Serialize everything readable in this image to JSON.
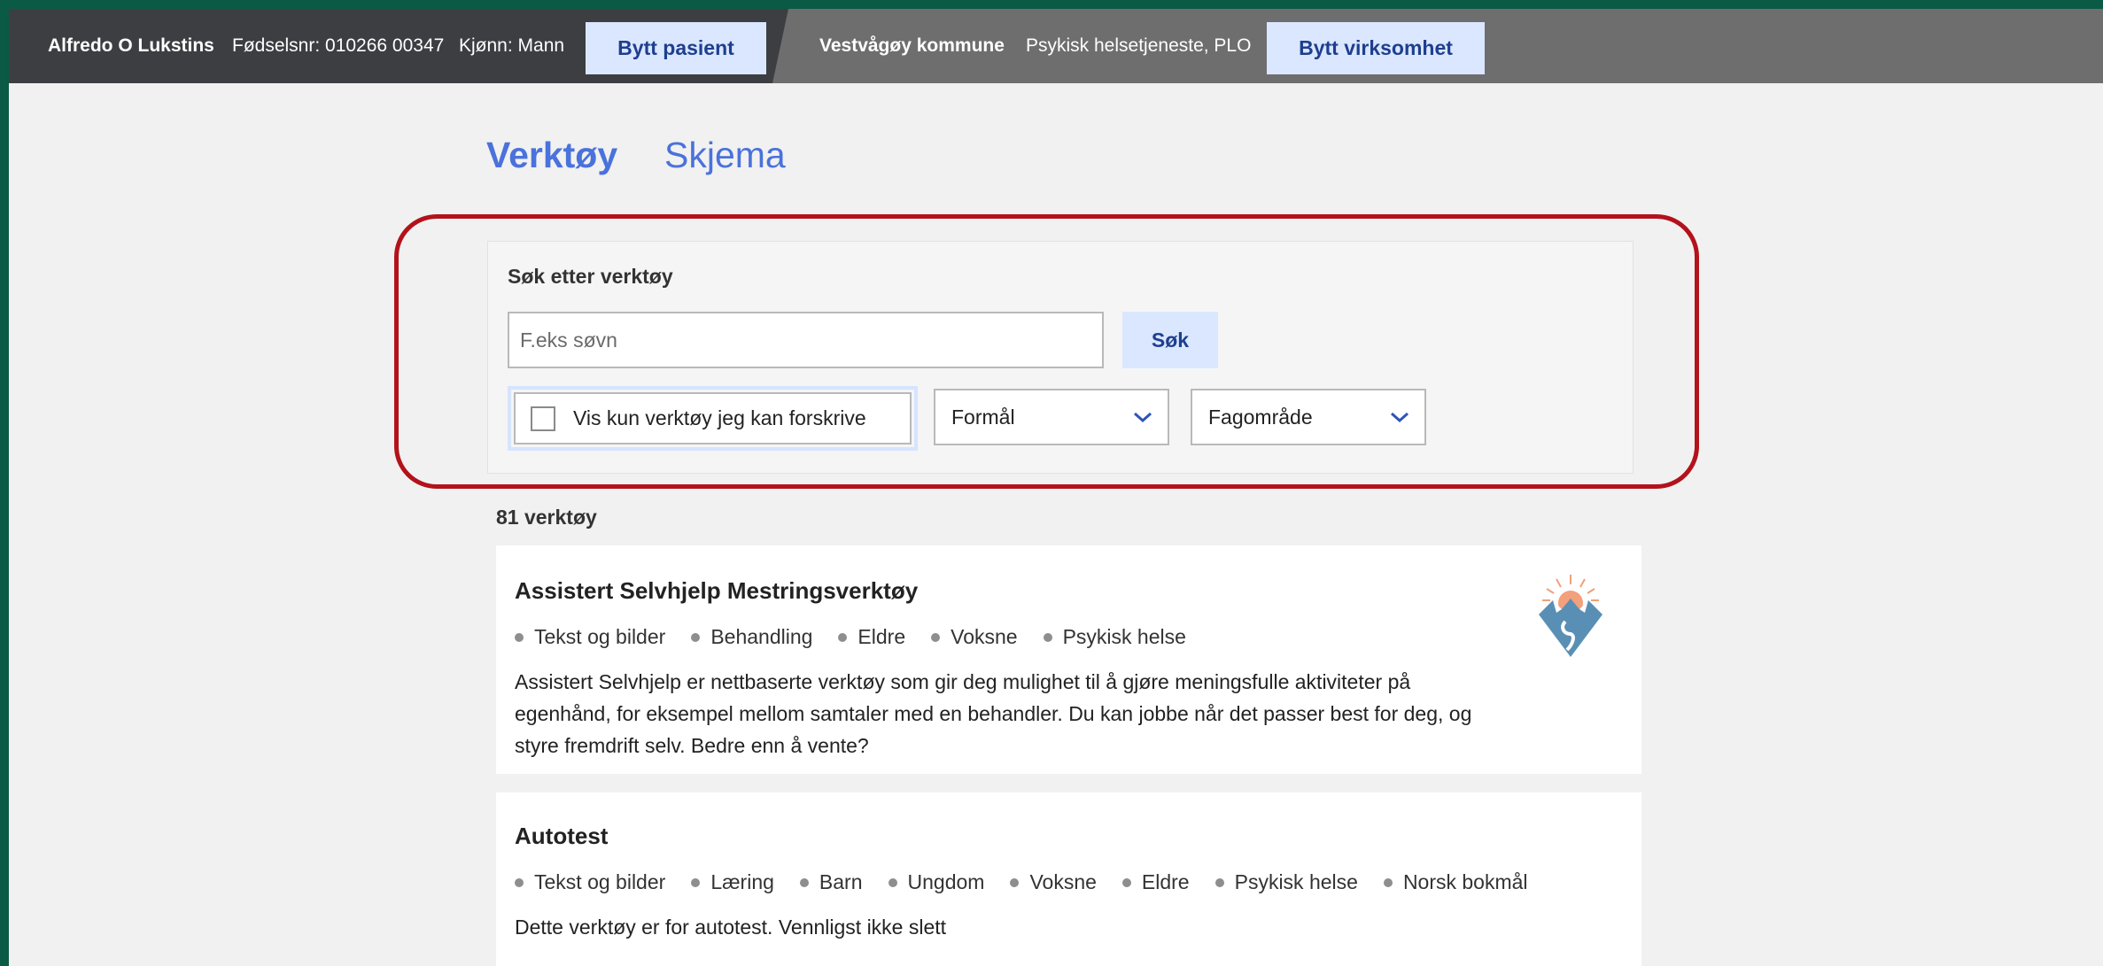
{
  "topbar": {
    "patient_name": "Alfredo O Lukstins",
    "birth_number": "Fødselsnr: 010266 00347",
    "gender": "Kjønn: Mann",
    "switch_patient_label": "Bytt pasient",
    "municipality": "Vestvågøy kommune",
    "department": "Psykisk helsetjeneste, PLO",
    "switch_business_label": "Bytt virksomhet"
  },
  "tabs": [
    {
      "label": "Verktøy",
      "active": true
    },
    {
      "label": "Skjema",
      "active": false
    }
  ],
  "search": {
    "title": "Søk etter verktøy",
    "placeholder": "F.eks søvn",
    "value": "",
    "button_label": "Søk",
    "checkbox_label": "Vis kun verktøy jeg kan forskrive",
    "checkbox_checked": false,
    "dropdowns": [
      {
        "label": "Formål"
      },
      {
        "label": "Fagområde"
      }
    ]
  },
  "results": {
    "count_label": "81 verktøy",
    "items": [
      {
        "title": "Assistert Selvhjelp Mestringsverktøy",
        "tags": [
          "Tekst og bilder",
          "Behandling",
          "Eldre",
          "Voksne",
          "Psykisk helse"
        ],
        "description": "Assistert Selvhjelp er nettbaserte verktøy som gir deg mulighet til å gjøre meningsfulle aktiviteter på egenhånd, for eksempel mellom samtaler med en behandler. Du kan jobbe når det passer best for deg, og styre fremdrift selv. Bedre enn å vente?",
        "logo_icon": "mountain-sun-logo-icon"
      },
      {
        "title": "Autotest",
        "tags": [
          "Tekst og bilder",
          "Læring",
          "Barn",
          "Ungdom",
          "Voksne",
          "Eldre",
          "Psykisk helse",
          "Norsk bokmål"
        ],
        "description": "Dette verktøy er for autotest. Vennligst ikke slett"
      }
    ]
  },
  "colors": {
    "frame": "#0a5a45",
    "topbar_dark": "#3c3e42",
    "topbar_light": "#6e6e6e",
    "button_bg": "#dbe7ff",
    "button_text": "#1e3f8f",
    "tab_blue": "#4a72dc",
    "highlight_red": "#b3121b"
  },
  "icons": {
    "dropdown": "chevron-down-icon",
    "checkbox": "checkbox-icon"
  }
}
